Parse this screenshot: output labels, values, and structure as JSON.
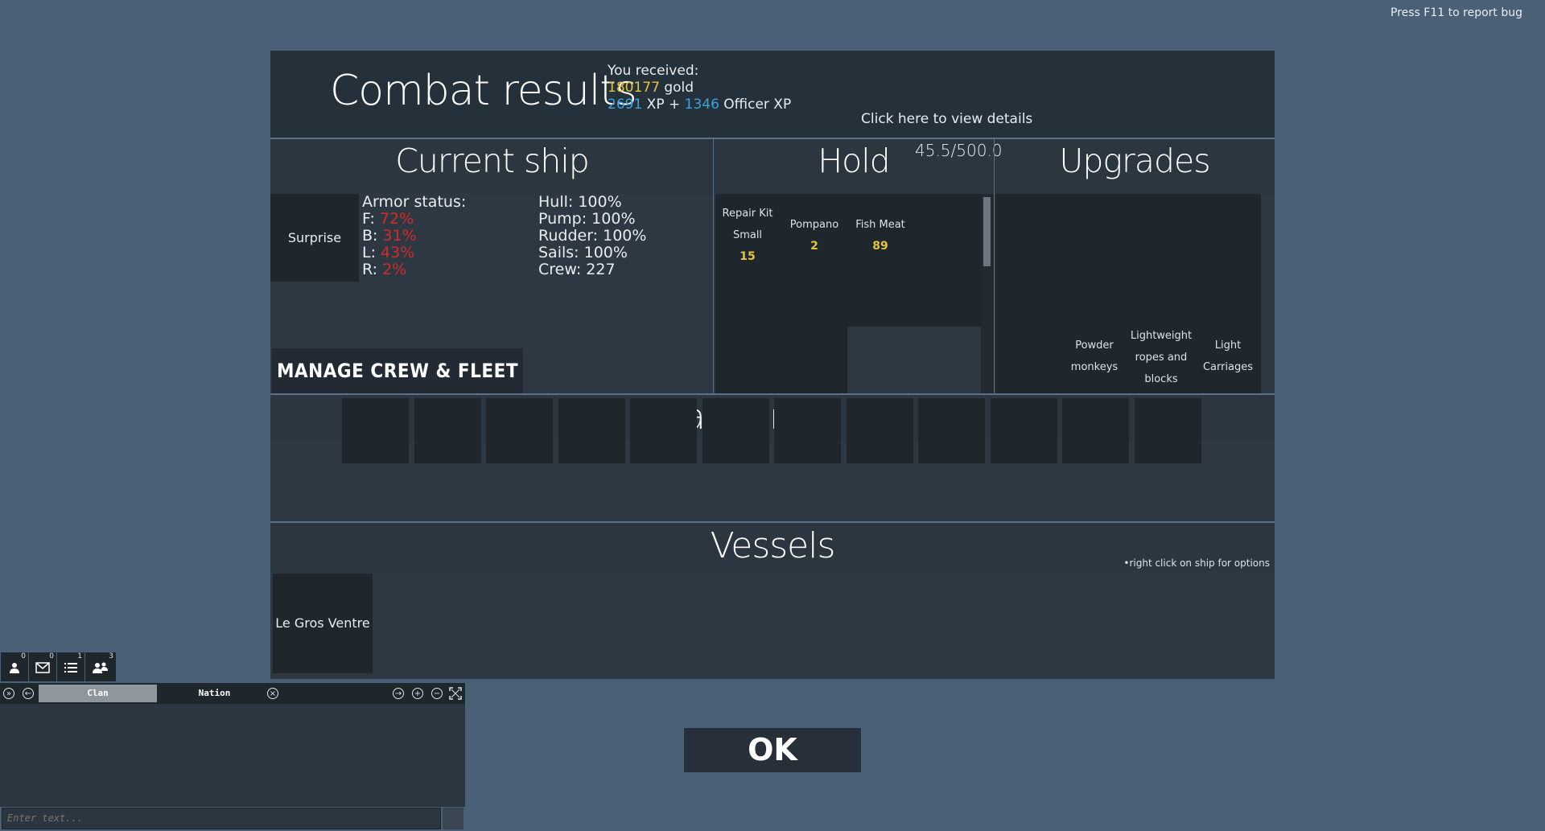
{
  "report_bug": "Press F11 to report bug",
  "combat": {
    "title": "Combat results",
    "received_label": "You received:",
    "gold_amount": "180177",
    "gold_label": "gold",
    "xp_amount": "2691",
    "xp_label": "XP +",
    "officer_xp_amount": "1346",
    "officer_xp_label": "Officer XP",
    "details_link": "Click here to view details"
  },
  "current_ship": {
    "title": "Current ship",
    "ship_name": "Surprise",
    "armor_label": "Armor status:",
    "armor": [
      {
        "label": "F:",
        "value": "72%"
      },
      {
        "label": "B:",
        "value": "31%"
      },
      {
        "label": "L:",
        "value": "43%"
      },
      {
        "label": "R:",
        "value": "2%"
      }
    ],
    "status": [
      "Hull: 100%",
      "Pump: 100%",
      "Rudder: 100%",
      "Sails: 100%",
      "Crew: 227"
    ],
    "manage_button": "MANAGE CREW & FLEET"
  },
  "hold": {
    "title": "Hold",
    "capacity": "45.5/500.0",
    "items": [
      {
        "name_line1": "Repair Kit",
        "name_line2": "Small",
        "count": "15"
      },
      {
        "name_line1": "Pompano",
        "name_line2": "",
        "count": "2"
      },
      {
        "name_line1": "Fish Meat",
        "name_line2": "",
        "count": "89"
      }
    ]
  },
  "upgrades": {
    "title": "Upgrades",
    "items": [
      {
        "line1": "Powder",
        "line2": "monkeys",
        "line3": ""
      },
      {
        "line1": "Lightweight",
        "line2": "ropes and",
        "line3": "blocks"
      },
      {
        "line1": "Light",
        "line2": "Carriages",
        "line3": ""
      }
    ]
  },
  "loot": {
    "title": "Unassigned loot",
    "slot_count": 12
  },
  "vessels": {
    "title": "Vessels",
    "hint": "•right click on ship for options",
    "ships": [
      "Le Gros Ventre"
    ]
  },
  "ok_label": "OK",
  "chat": {
    "icon_badges": [
      "0",
      "0",
      "1",
      "3"
    ],
    "tab_clan": "Clan",
    "tab_nation": "Nation",
    "input_placeholder": "Enter text..."
  },
  "colors": {
    "gold": "#e5c53a",
    "xp": "#3aa3dc",
    "damage": "#d42a2a"
  }
}
